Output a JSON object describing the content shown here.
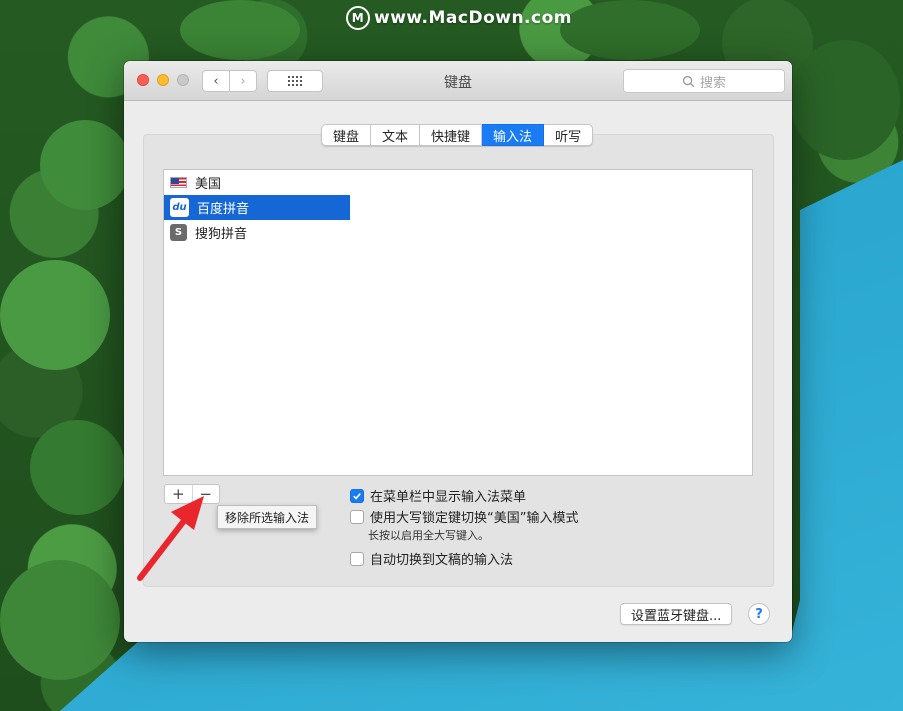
{
  "watermark": {
    "logo": "M",
    "text": "www.MacDown.com"
  },
  "window": {
    "title": "键盘",
    "nav": {
      "back_icon": "‹",
      "forward_icon": "›"
    },
    "search_placeholder": "搜索"
  },
  "tabs": [
    {
      "label": "键盘",
      "active": false
    },
    {
      "label": "文本",
      "active": false
    },
    {
      "label": "快捷键",
      "active": false
    },
    {
      "label": "输入法",
      "active": true
    },
    {
      "label": "听写",
      "active": false
    }
  ],
  "input_sources": [
    {
      "label": "美国",
      "icon": "us-flag-icon",
      "selected": false
    },
    {
      "label": "百度拼音",
      "icon": "baidu-pinyin-icon",
      "icon_text": "du",
      "selected": true
    },
    {
      "label": "搜狗拼音",
      "icon": "sogou-pinyin-icon",
      "icon_text": "S",
      "selected": false
    }
  ],
  "list_controls": {
    "add": "+",
    "remove": "−",
    "remove_tooltip": "移除所选输入法"
  },
  "options": {
    "show_menu": {
      "label": "在菜单栏中显示输入法菜单",
      "checked": true
    },
    "caps_lock": {
      "label": "使用大写锁定键切换“美国”输入模式",
      "checked": false
    },
    "caps_lock_hint": "长按以启用全大写键入。",
    "auto_switch": {
      "label": "自动切换到文稿的输入法",
      "checked": false
    }
  },
  "footer": {
    "bluetooth_button": "设置蓝牙键盘...",
    "help": "?"
  },
  "colors": {
    "accent": "#1a7cf5",
    "selection": "#1567d5",
    "arrow": "#e8262c"
  }
}
